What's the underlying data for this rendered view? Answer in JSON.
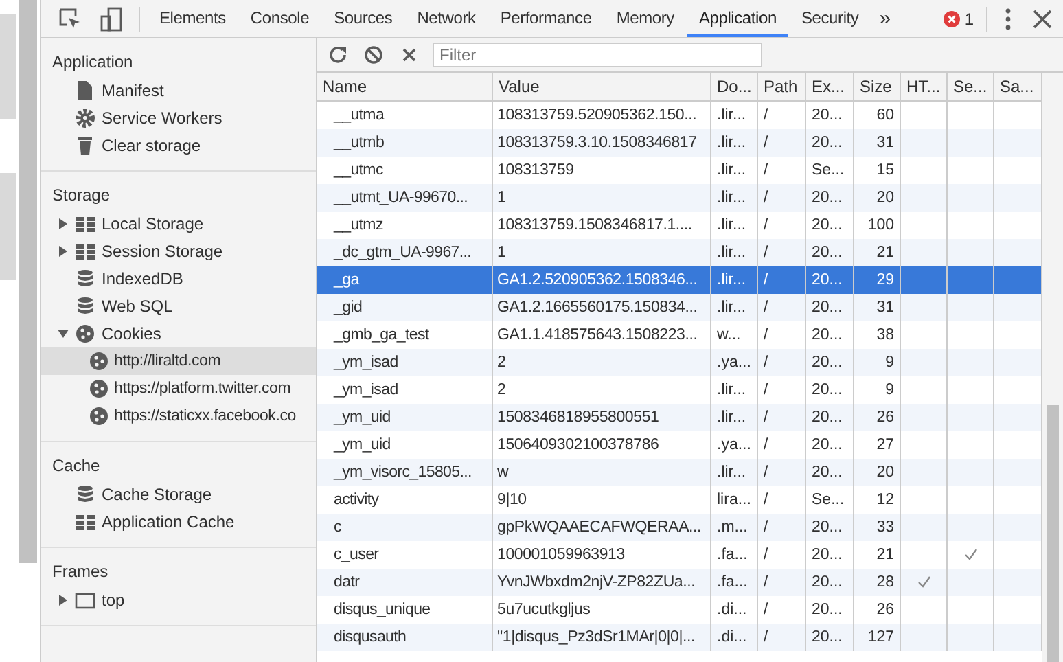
{
  "tabs": [
    {
      "label": "Elements",
      "selected": false
    },
    {
      "label": "Console",
      "selected": false
    },
    {
      "label": "Sources",
      "selected": false
    },
    {
      "label": "Network",
      "selected": false
    },
    {
      "label": "Performance",
      "selected": false
    },
    {
      "label": "Memory",
      "selected": false
    },
    {
      "label": "Application",
      "selected": true
    },
    {
      "label": "Security",
      "selected": false
    }
  ],
  "more_tabs": "»",
  "error_count": "1",
  "sidebar": {
    "sections": [
      {
        "title": "Application",
        "items": [
          {
            "label": "Manifest",
            "kind": "file"
          },
          {
            "label": "Service Workers",
            "kind": "gear"
          },
          {
            "label": "Clear storage",
            "kind": "trash"
          }
        ]
      },
      {
        "title": "Storage",
        "items": [
          {
            "label": "Local Storage",
            "kind": "grid",
            "expanded": false
          },
          {
            "label": "Session Storage",
            "kind": "grid",
            "expanded": false
          },
          {
            "label": "IndexedDB",
            "kind": "db"
          },
          {
            "label": "Web SQL",
            "kind": "db"
          },
          {
            "label": "Cookies",
            "kind": "cookie",
            "expanded": true,
            "children": [
              {
                "label": "http://liraltd.com",
                "kind": "cookie",
                "selected": true
              },
              {
                "label": "https://platform.twitter.com",
                "kind": "cookie",
                "selected": false
              },
              {
                "label": "https://staticxx.facebook.co",
                "kind": "cookie",
                "selected": false
              }
            ]
          }
        ]
      },
      {
        "title": "Cache",
        "items": [
          {
            "label": "Cache Storage",
            "kind": "db"
          },
          {
            "label": "Application Cache",
            "kind": "grid"
          }
        ]
      },
      {
        "title": "Frames",
        "items": [
          {
            "label": "top",
            "kind": "frame",
            "expanded": false
          }
        ]
      }
    ]
  },
  "toolbar": {
    "filter": {
      "placeholder": "Filter"
    }
  },
  "table": {
    "columns": [
      "Name",
      "Value",
      "Do...",
      "Path",
      "Ex...",
      "Size",
      "HT...",
      "Se...",
      "Sa..."
    ],
    "rows": [
      {
        "cells": [
          "__utma",
          "108313759.520905362.150...",
          ".lir...",
          "/",
          "20...",
          "60"
        ],
        "http_only": false,
        "secure": false,
        "selected": false
      },
      {
        "cells": [
          "__utmb",
          "108313759.3.10.1508346817",
          ".lir...",
          "/",
          "20...",
          "31"
        ],
        "http_only": false,
        "secure": false,
        "selected": false
      },
      {
        "cells": [
          "__utmc",
          "108313759",
          ".lir...",
          "/",
          "Se...",
          "15"
        ],
        "http_only": false,
        "secure": false,
        "selected": false
      },
      {
        "cells": [
          "__utmt_UA-99670...",
          "1",
          ".lir...",
          "/",
          "20...",
          "20"
        ],
        "http_only": false,
        "secure": false,
        "selected": false
      },
      {
        "cells": [
          "__utmz",
          "108313759.1508346817.1....",
          ".lir...",
          "/",
          "20...",
          "100"
        ],
        "http_only": false,
        "secure": false,
        "selected": false
      },
      {
        "cells": [
          "_dc_gtm_UA-9967...",
          "1",
          ".lir...",
          "/",
          "20...",
          "21"
        ],
        "http_only": false,
        "secure": false,
        "selected": false
      },
      {
        "cells": [
          "_ga",
          "GA1.2.520905362.1508346...",
          ".lir...",
          "/",
          "20...",
          "29"
        ],
        "http_only": false,
        "secure": false,
        "selected": true
      },
      {
        "cells": [
          "_gid",
          "GA1.2.1665560175.150834...",
          ".lir...",
          "/",
          "20...",
          "31"
        ],
        "http_only": false,
        "secure": false,
        "selected": false
      },
      {
        "cells": [
          "_gmb_ga_test",
          "GA1.1.418575643.1508223...",
          "w...",
          "/",
          "20...",
          "38"
        ],
        "http_only": false,
        "secure": false,
        "selected": false
      },
      {
        "cells": [
          "_ym_isad",
          "2",
          ".ya...",
          "/",
          "20...",
          "9"
        ],
        "http_only": false,
        "secure": false,
        "selected": false
      },
      {
        "cells": [
          "_ym_isad",
          "2",
          ".lir...",
          "/",
          "20...",
          "9"
        ],
        "http_only": false,
        "secure": false,
        "selected": false
      },
      {
        "cells": [
          "_ym_uid",
          "1508346818955800551",
          ".lir...",
          "/",
          "20...",
          "26"
        ],
        "http_only": false,
        "secure": false,
        "selected": false
      },
      {
        "cells": [
          "_ym_uid",
          "1506409302100378786",
          ".ya...",
          "/",
          "20...",
          "27"
        ],
        "http_only": false,
        "secure": false,
        "selected": false
      },
      {
        "cells": [
          "_ym_visorc_15805...",
          "w",
          ".lir...",
          "/",
          "20...",
          "20"
        ],
        "http_only": false,
        "secure": false,
        "selected": false
      },
      {
        "cells": [
          "activity",
          "9|10",
          "lira...",
          "/",
          "Se...",
          "12"
        ],
        "http_only": false,
        "secure": false,
        "selected": false
      },
      {
        "cells": [
          "c",
          "gpPkWQAAECAFWQERAA...",
          ".m...",
          "/",
          "20...",
          "33"
        ],
        "http_only": false,
        "secure": false,
        "selected": false
      },
      {
        "cells": [
          "c_user",
          "100001059963913",
          ".fa...",
          "/",
          "20...",
          "21"
        ],
        "http_only": false,
        "secure": true,
        "selected": false
      },
      {
        "cells": [
          "datr",
          "YvnJWbxdm2njV-ZP82ZUa...",
          ".fa...",
          "/",
          "20...",
          "28"
        ],
        "http_only": true,
        "secure": false,
        "selected": false
      },
      {
        "cells": [
          "disqus_unique",
          "5u7ucutkgljus",
          ".di...",
          "/",
          "20...",
          "26"
        ],
        "http_only": false,
        "secure": false,
        "selected": false
      },
      {
        "cells": [
          "disqusauth",
          "\"1|disqus_Pz3dSr1MAr|0|0|...",
          ".di...",
          "/",
          "20...",
          "127"
        ],
        "http_only": false,
        "secure": false,
        "selected": false
      }
    ]
  }
}
